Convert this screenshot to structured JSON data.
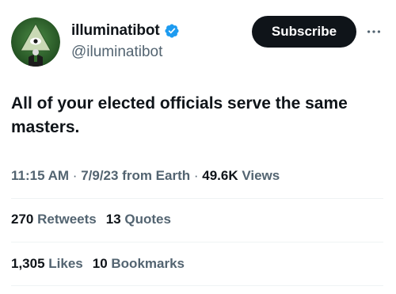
{
  "author": {
    "display_name": "illuminatibot",
    "handle": "@iluminatibot",
    "verified_icon": "verified-badge-icon",
    "avatar_icon": "illuminati-eye-pyramid-avatar"
  },
  "header": {
    "subscribe_label": "Subscribe",
    "more_icon": "more-horizontal-icon"
  },
  "tweet": {
    "text": "All of your elected officials serve the same masters."
  },
  "meta": {
    "time": "11:15 AM",
    "sep1": " · ",
    "date": "7/9/23",
    "source": " from Earth",
    "sep2": " · ",
    "views_count": "49.6K",
    "views_label": " Views"
  },
  "stats": {
    "retweets_count": "270",
    "retweets_label": " Retweets",
    "quotes_count": "13",
    "quotes_label": " Quotes",
    "likes_count": "1,305",
    "likes_label": " Likes",
    "bookmarks_count": "10",
    "bookmarks_label": " Bookmarks"
  },
  "colors": {
    "text_primary": "#0f1419",
    "text_secondary": "#536471",
    "verified_blue": "#1d9bf0",
    "divider": "#eff3f4",
    "button_bg": "#0f1419"
  }
}
